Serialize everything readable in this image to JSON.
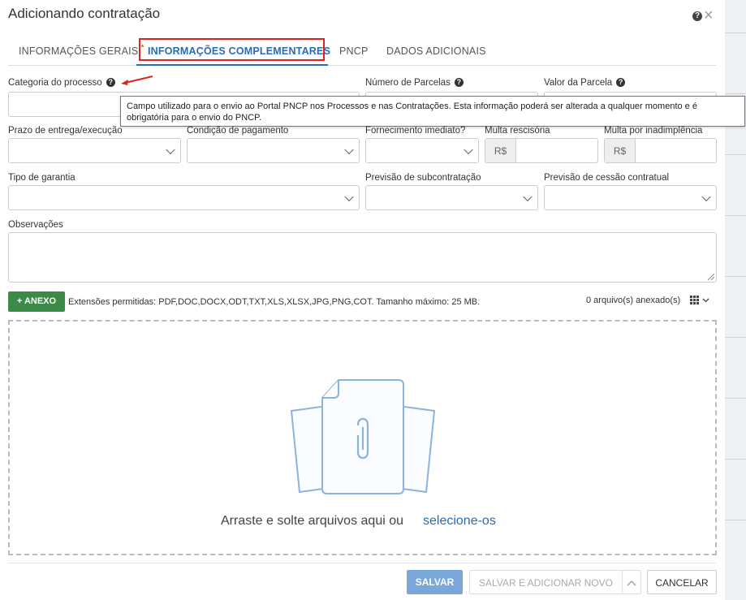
{
  "modal": {
    "title": "Adicionando contratação",
    "help_icon": "question-circle-icon",
    "close_icon": "close-icon"
  },
  "tabs": [
    {
      "label": "INFORMAÇÕES GERAIS",
      "required": "*"
    },
    {
      "label": "INFORMAÇÕES COMPLEMENTARES",
      "active": true
    },
    {
      "label": "PNCP"
    },
    {
      "label": "DADOS ADICIONAIS"
    }
  ],
  "fields": {
    "categoria": {
      "label": "Categoria do processo",
      "value": ""
    },
    "numero_parcelas": {
      "label": "Número de Parcelas",
      "value": ""
    },
    "valor_parcela": {
      "label": "Valor da Parcela",
      "value": ""
    },
    "prazo": {
      "label": "Prazo de entrega/execução",
      "value": ""
    },
    "condicao": {
      "label": "Condição de pagamento",
      "value": ""
    },
    "fornecimento": {
      "label": "Fornecimento imediato?",
      "value": ""
    },
    "multa_rescisoria": {
      "label": "Multa rescisória",
      "prefix": "R$",
      "value": ""
    },
    "multa_inadimplencia": {
      "label": "Multa por inadimplência",
      "prefix": "R$",
      "value": ""
    },
    "tipo_garantia": {
      "label": "Tipo de garantia",
      "value": ""
    },
    "subcontratacao": {
      "label": "Previsão de subcontratação",
      "value": ""
    },
    "cessao": {
      "label": "Previsão de cessão contratual",
      "value": ""
    },
    "observacoes": {
      "label": "Observações",
      "value": ""
    }
  },
  "tooltip": {
    "line1": "Campo utilizado para o envio ao Portal PNCP nos Processos e nas Contratações. Esta informação poderá ser alterada a qualquer momento e é",
    "line2": "obrigatória para o envio do PNCP."
  },
  "attachments": {
    "add_button": "+ ANEXO",
    "extensions": "Extensões permitidas: PDF,DOC,DOCX,ODT,TXT,XLS,XLSX,JPG,PNG,COT. Tamanho máximo: 25 MB.",
    "count": "0 arquivo(s) anexado(s)",
    "drop_text": "Arraste e solte arquivos aqui ou",
    "drop_link": "selecione-os"
  },
  "footer": {
    "save": "SALVAR",
    "save_add": "SALVAR E ADICIONAR NOVO",
    "cancel": "CANCELAR"
  },
  "colors": {
    "accent": "#2a6bb5",
    "highlight_box": "#e0211d",
    "anexo_button": "#3c8a47",
    "save_button": "#7aa7da"
  }
}
